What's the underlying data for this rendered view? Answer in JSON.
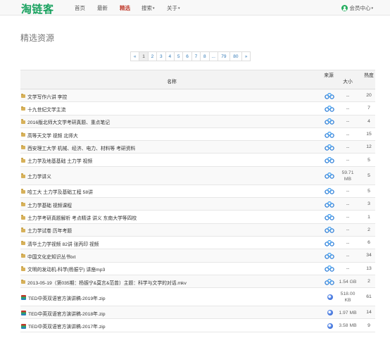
{
  "nav": {
    "logo": "淘链客",
    "items": [
      {
        "label": "首页",
        "active": false,
        "caret": false
      },
      {
        "label": "最新",
        "active": false,
        "caret": false
      },
      {
        "label": "精选",
        "active": true,
        "caret": false
      },
      {
        "label": "搜索",
        "active": false,
        "caret": true
      },
      {
        "label": "关于",
        "active": false,
        "caret": true
      }
    ],
    "member_label": "会员中心"
  },
  "page_title": "精选资源",
  "pagination": [
    "«",
    "1",
    "2",
    "3",
    "4",
    "5",
    "6",
    "7",
    "8",
    "...",
    "79",
    "80",
    "»"
  ],
  "pagination_active": "1",
  "table": {
    "headers": {
      "name": "名称",
      "source": "来源",
      "size": "大小",
      "heat": "热度"
    },
    "rows": [
      {
        "type": "folder",
        "name": "文学写作六讲 李控",
        "source": "baidu",
        "size": "--",
        "heat": "20"
      },
      {
        "type": "folder",
        "name": "十九世纪文学主流",
        "source": "baidu",
        "size": "--",
        "heat": "7"
      },
      {
        "type": "folder",
        "name": "2016版北师大文学考研真题、重点笔记",
        "source": "baidu",
        "size": "--",
        "heat": "4"
      },
      {
        "type": "folder",
        "name": "高等天文学 视频 北师大",
        "source": "baidu",
        "size": "--",
        "heat": "15"
      },
      {
        "type": "folder",
        "name": "西安理工大学 机械、经济、电力、材料等 考研资料",
        "source": "baidu",
        "size": "--",
        "heat": "12"
      },
      {
        "type": "folder",
        "name": "土力学及地基基础 土力学 视频",
        "source": "baidu",
        "size": "--",
        "heat": "5"
      },
      {
        "type": "folder",
        "name": "土力学讲义",
        "source": "baidu",
        "size": "59.71 MB",
        "heat": "5"
      },
      {
        "type": "folder",
        "name": "哈工大 土力学及基础工程 58讲",
        "source": "baidu",
        "size": "--",
        "heat": "5"
      },
      {
        "type": "folder",
        "name": "土力学基础 视频课程",
        "source": "baidu",
        "size": "--",
        "heat": "3"
      },
      {
        "type": "folder",
        "name": "土力学考研真题解析 考点精讲 讲义 东南大学等四校",
        "source": "baidu",
        "size": "--",
        "heat": "1"
      },
      {
        "type": "folder",
        "name": "土力学试卷 历年考题",
        "source": "baidu",
        "size": "--",
        "heat": "2"
      },
      {
        "type": "folder",
        "name": "清华土力学视频 82讲 张丙印 视频",
        "source": "baidu",
        "size": "--",
        "heat": "6"
      },
      {
        "type": "folder",
        "name": "中国文化史知识丛书txt",
        "source": "baidu",
        "size": "--",
        "heat": "34"
      },
      {
        "type": "folder",
        "name": "文明的发动机-科学(杨振宁) 讲座mp3",
        "source": "baidu",
        "size": "--",
        "heat": "13"
      },
      {
        "type": "folder",
        "name": "2013-05-19（第035期：杨振宁&莫言&范曾）主题：科学与文学的对话.mkv",
        "source": "baidu",
        "size": "1.54 GB",
        "heat": "2"
      },
      {
        "type": "file",
        "name": "TED中英双语官方演讲稿-2019年.zip",
        "source": "e",
        "size": "518.00 KB",
        "heat": "61"
      },
      {
        "type": "file",
        "name": "TED中英双语官方演讲稿-2018年.zip",
        "source": "e",
        "size": "1.97 MB",
        "heat": "14"
      },
      {
        "type": "file",
        "name": "TED中英双语官方演讲稿-2017年.zip",
        "source": "e",
        "size": "3.58 MB",
        "heat": "9"
      }
    ]
  }
}
